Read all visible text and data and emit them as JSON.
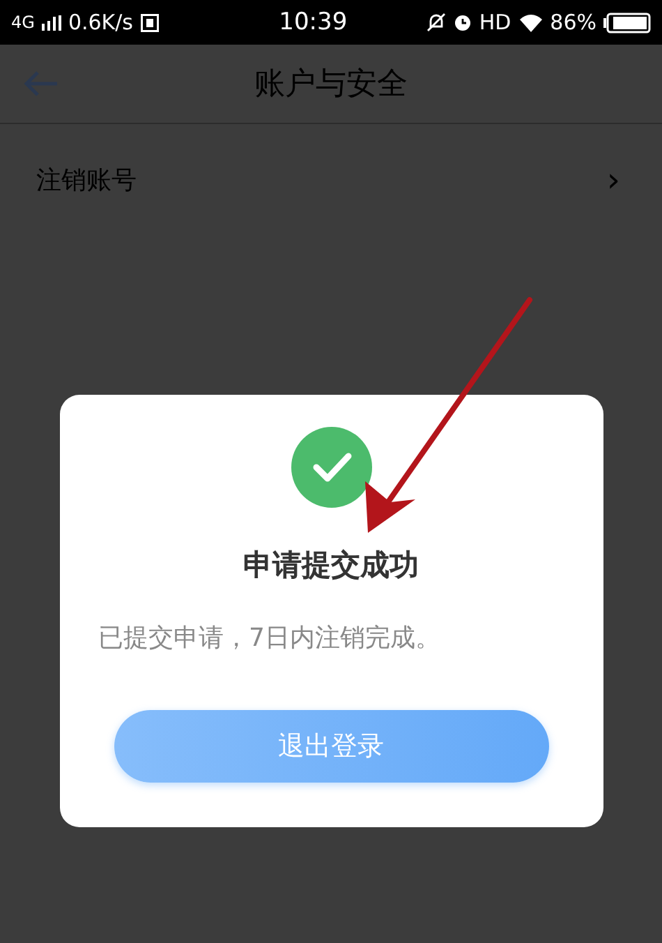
{
  "status_bar": {
    "network": "4G",
    "speed": "0.6K/s",
    "time": "10:39",
    "hd": "HD",
    "battery": "86%"
  },
  "header": {
    "title": "账户与安全"
  },
  "menu": [
    {
      "label": "注销账号",
      "chevron": "›"
    }
  ],
  "dialog": {
    "title": "申请提交成功",
    "message": "已提交申请，7日内注销完成。",
    "button": "退出登录"
  }
}
